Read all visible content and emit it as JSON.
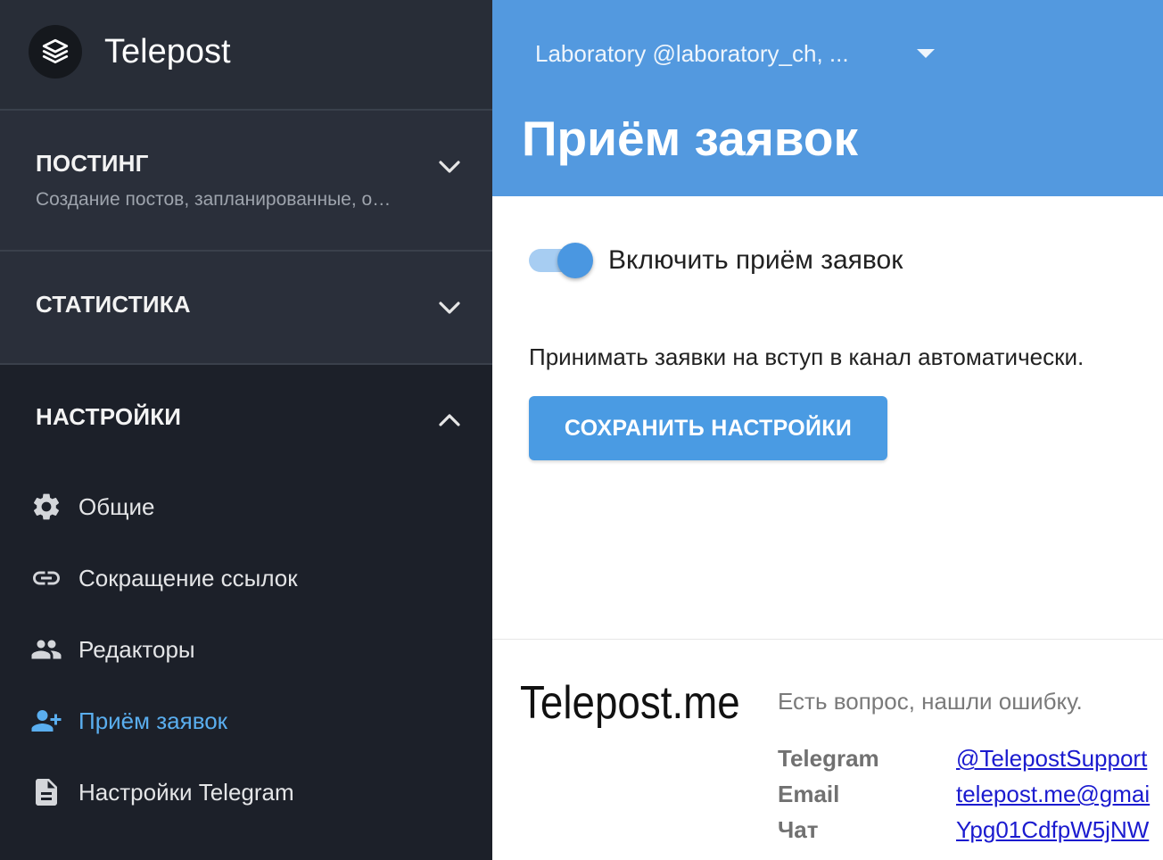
{
  "app": {
    "name": "Telepost"
  },
  "sidebar": {
    "posting": {
      "title": "ПОСТИНГ",
      "subtitle": "Создание постов, запланированные, о…",
      "expanded": false
    },
    "stats": {
      "title": "СТАТИСТИКА",
      "expanded": false
    },
    "settings": {
      "title": "НАСТРОЙКИ",
      "expanded": true,
      "items": [
        {
          "label": "Общие",
          "icon": "gear-icon",
          "active": false
        },
        {
          "label": "Сокращение ссылок",
          "icon": "link-icon",
          "active": false
        },
        {
          "label": "Редакторы",
          "icon": "people-icon",
          "active": false
        },
        {
          "label": "Приём заявок",
          "icon": "person-add-icon",
          "active": true
        },
        {
          "label": "Настройки Telegram",
          "icon": "document-icon",
          "active": false
        }
      ]
    }
  },
  "header": {
    "channel": "Laboratory @laboratory_ch, ...",
    "title": "Приём заявок"
  },
  "main": {
    "toggle": {
      "label": "Включить приём заявок",
      "checked": true
    },
    "description": "Принимать заявки на вступ в канал автоматически.",
    "save_button": "СОХРАНИТЬ НАСТРОЙКИ"
  },
  "footer": {
    "brand": "Telepost.me",
    "question": "Есть вопрос, нашли ошибку.",
    "contacts": [
      {
        "label": "Telegram",
        "value": "@TelepostSupport"
      },
      {
        "label": "Email",
        "value": "telepost.me@gmai"
      },
      {
        "label": "Чат",
        "value": "Ypg01CdfpW5jNW"
      }
    ]
  },
  "colors": {
    "header_bg": "#5399df",
    "accent": "#4a9be3",
    "active_item": "#5aaeef",
    "sidebar_bg": "#1c2029",
    "sidebar_section_bg": "#2a2f3a"
  }
}
